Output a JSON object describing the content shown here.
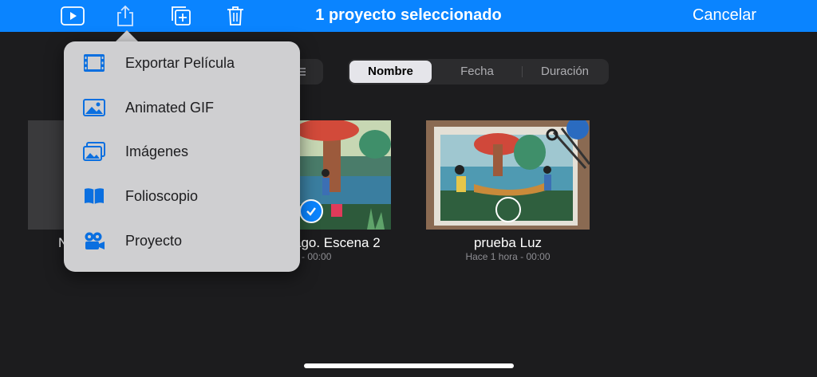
{
  "topbar": {
    "title": "1 proyecto seleccionado",
    "cancel_label": "Cancelar",
    "icons": [
      "play-icon",
      "share-icon",
      "duplicate-icon",
      "trash-icon"
    ]
  },
  "sort": {
    "options": [
      "Nombre",
      "Fecha",
      "Duración"
    ],
    "selected": "Nombre"
  },
  "projects": [
    {
      "name": "N",
      "meta": ""
    },
    {
      "name": "ago. Escena 2",
      "meta": "a - 00:00",
      "selected": true
    },
    {
      "name": "prueba Luz",
      "meta": "Hace 1 hora - 00:00"
    }
  ],
  "share_menu": {
    "items": [
      {
        "label": "Exportar Película",
        "icon": "film-icon"
      },
      {
        "label": "Animated GIF",
        "icon": "image-icon"
      },
      {
        "label": "Imágenes",
        "icon": "images-icon"
      },
      {
        "label": "Folioscopio",
        "icon": "book-icon"
      },
      {
        "label": "Proyecto",
        "icon": "camera-icon"
      }
    ]
  },
  "colors": {
    "accent": "#0a84ff",
    "background": "#1c1c1e"
  }
}
